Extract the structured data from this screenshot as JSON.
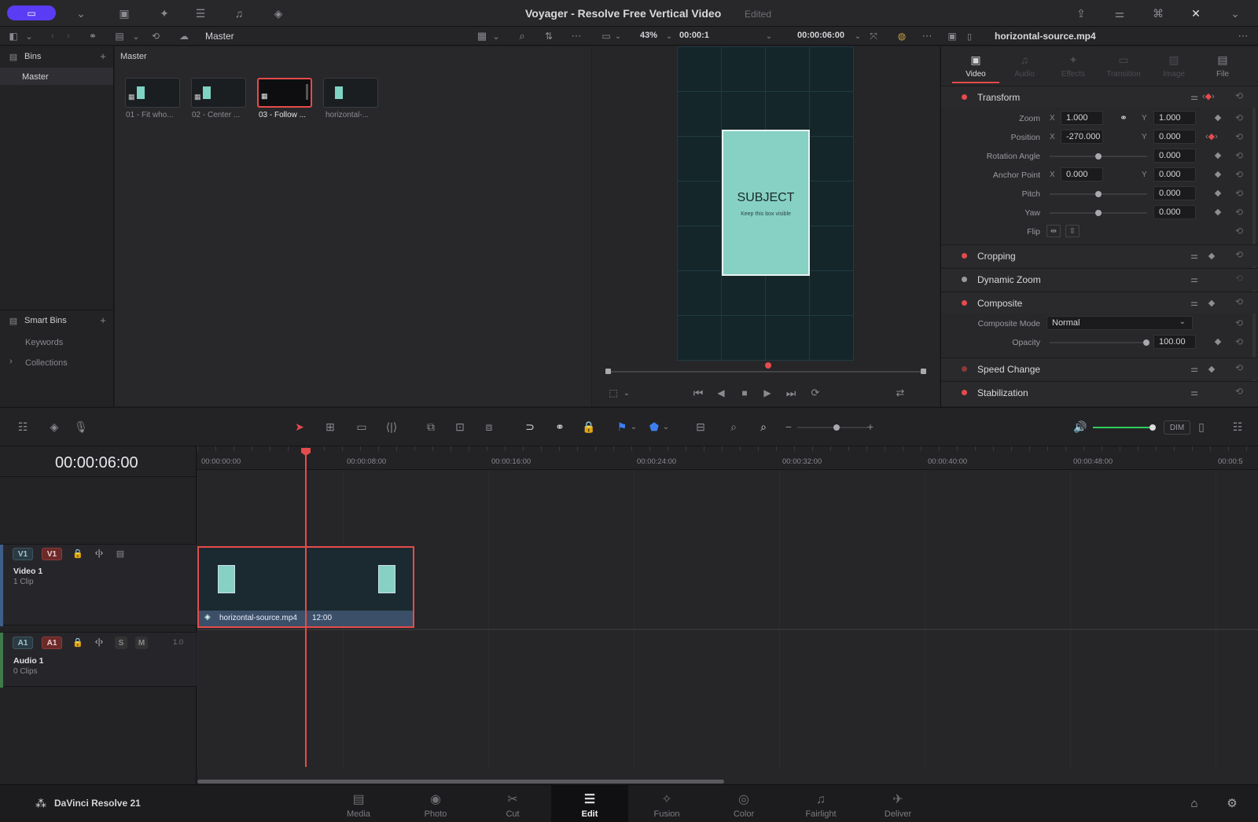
{
  "titlebar": {
    "title": "Voyager - Resolve Free Vertical Video",
    "status": "Edited"
  },
  "toolbar": {
    "bin_label": "Master",
    "zoom": "43%",
    "timecode_left": "00:00:1",
    "timecode_right": "00:00:06:00",
    "clip_name": "horizontal-source.mp4"
  },
  "bins": {
    "header": "Bins",
    "items": [
      "Master"
    ],
    "smart_bins": "Smart Bins",
    "smart_items": [
      "Keywords",
      "Collections"
    ]
  },
  "mediapool": {
    "breadcrumb": "Master",
    "clips": [
      "01 - Fit who...",
      "02 - Center ...",
      "03 - Follow ...",
      "horizontal-..."
    ]
  },
  "viewer": {
    "subject_title": "SUBJECT",
    "subject_sub": "Keep this box visible"
  },
  "inspector": {
    "tabs": [
      "Video",
      "Audio",
      "Effects",
      "Transition",
      "Image",
      "File"
    ],
    "transform": "Transform",
    "zoom_label": "Zoom",
    "zoom_x": "1.000",
    "zoom_y": "1.000",
    "position_label": "Position",
    "pos_x": "-270.000",
    "pos_y": "0.000",
    "rotation_label": "Rotation Angle",
    "rotation": "0.000",
    "anchor_label": "Anchor Point",
    "anchor_x": "0.000",
    "anchor_y": "0.000",
    "pitch_label": "Pitch",
    "pitch": "0.000",
    "yaw_label": "Yaw",
    "yaw": "0.000",
    "flip_label": "Flip",
    "x": "X",
    "y": "Y",
    "cropping": "Cropping",
    "dynamic_zoom": "Dynamic Zoom",
    "composite": "Composite",
    "composite_mode_label": "Composite Mode",
    "composite_mode": "Normal",
    "opacity_label": "Opacity",
    "opacity": "100.00",
    "speed_change": "Speed Change",
    "stabilization": "Stabilization"
  },
  "timeline": {
    "timecode": "00:00:06:00",
    "ticks": [
      "00:00:00:00",
      "00:00:08:00",
      "00:00:16:00",
      "00:00:24:00",
      "00:00:32:00",
      "00:00:40:00",
      "00:00:48:00",
      "00:00:5"
    ],
    "dim": "DIM",
    "video_track": {
      "tag": "V1",
      "name": "Video 1",
      "clips": "1 Clip"
    },
    "audio_track": {
      "tag": "A1",
      "name": "Audio 1",
      "clips": "0 Clips",
      "level": "1.0",
      "solo": "S",
      "mute": "M"
    },
    "clip": {
      "name": "horizontal-source.mp4",
      "duration": "12:00"
    }
  },
  "bottom": {
    "app": "DaVinci Resolve 21",
    "pages": [
      "Media",
      "Photo",
      "Cut",
      "Edit",
      "Fusion",
      "Color",
      "Fairlight",
      "Deliver"
    ],
    "active": "Edit"
  },
  "colors": {
    "accent": "#e64b4b",
    "selection": "#5a3cf0",
    "teal": "#7fd3c3"
  }
}
